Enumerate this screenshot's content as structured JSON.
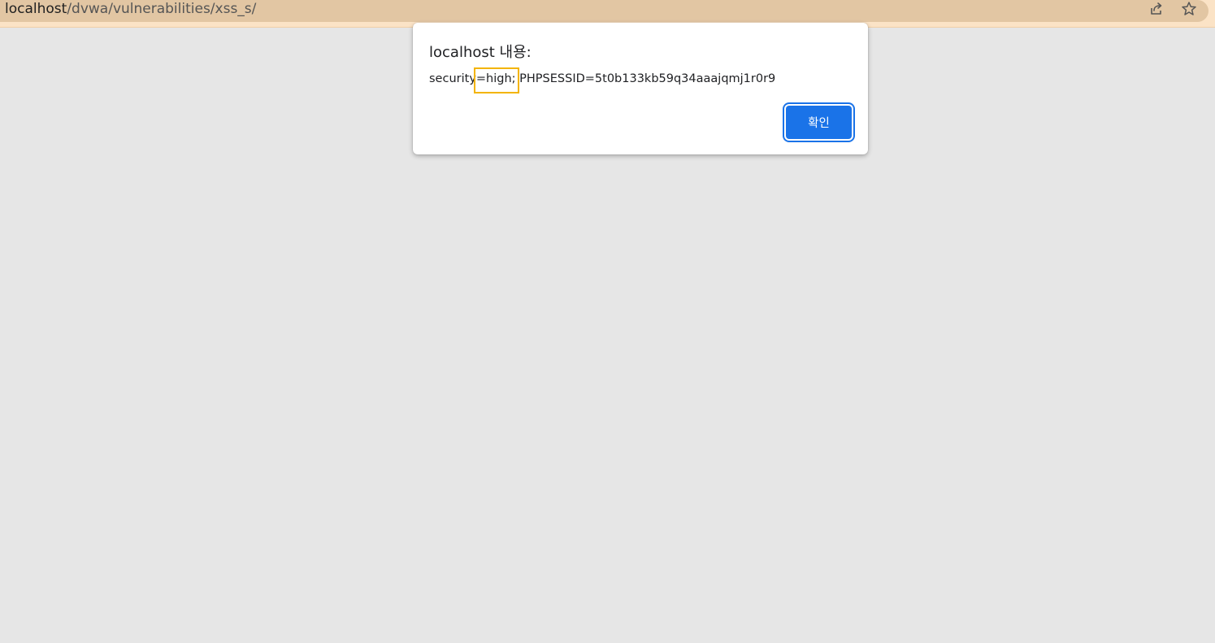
{
  "browser": {
    "url_host": "localhost",
    "url_path": "/dvwa/vulnerabilities/xss_s/",
    "share_icon": "share-icon",
    "bookmark_icon": "star-icon"
  },
  "dialog": {
    "title": "localhost 내용:",
    "message": "security=high; PHPSESSID=5t0b133kb59q34aaajqmj1r0r9",
    "ok_label": "확인",
    "highlight_color": "#f3b400",
    "button_color": "#1a73e8"
  }
}
